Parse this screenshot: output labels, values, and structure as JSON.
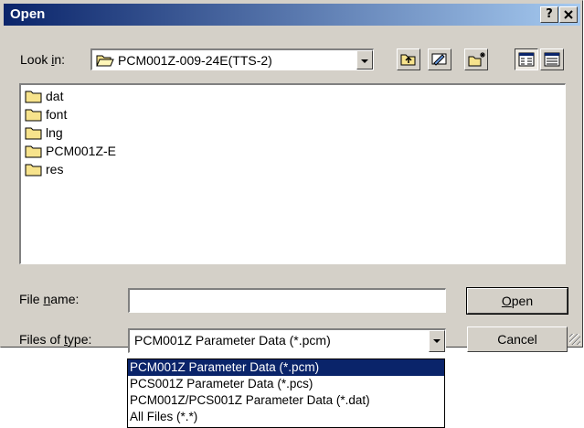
{
  "window": {
    "title": "Open",
    "help_label": "?",
    "close_label": "x"
  },
  "look_in": {
    "label_pre": "Look ",
    "label_hot": "i",
    "label_post": "n:",
    "value": "PCM001Z-009-24E(TTS-2)"
  },
  "toolbar": {
    "icons": [
      "up-one-level-icon",
      "desktop-icon",
      "new-folder-icon",
      "list-view-icon",
      "details-view-icon"
    ]
  },
  "files": [
    {
      "name": "dat",
      "icon": "folder-icon"
    },
    {
      "name": "font",
      "icon": "folder-icon"
    },
    {
      "name": "lng",
      "icon": "folder-icon"
    },
    {
      "name": "PCM001Z-E",
      "icon": "folder-icon"
    },
    {
      "name": "res",
      "icon": "folder-icon"
    }
  ],
  "file_name": {
    "label_pre": "File ",
    "label_hot": "n",
    "label_post": "ame:",
    "value": ""
  },
  "file_type": {
    "label_pre": "Files of ",
    "label_hot": "t",
    "label_post": "ype:",
    "value": "PCM001Z Parameter Data (*.pcm)",
    "options": [
      "PCM001Z Parameter Data (*.pcm)",
      "PCS001Z Parameter Data (*.pcs)",
      "PCM001Z/PCS001Z Parameter Data (*.dat)",
      "All Files (*.*)"
    ]
  },
  "buttons": {
    "open_hot": "O",
    "open_rest": "pen",
    "cancel": "Cancel"
  },
  "colors": {
    "title_start": "#0a246a",
    "title_end": "#a6caf0",
    "face": "#d4d0c8",
    "selection": "#0a246a",
    "folder": "#f7e38c"
  }
}
